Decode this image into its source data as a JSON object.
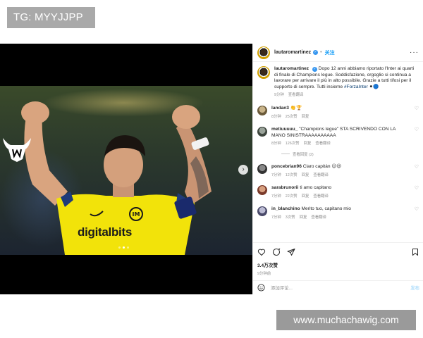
{
  "overlay": {
    "tg_label": "TG: MYYJJPP",
    "site_watermark": "www.muchachawig.com"
  },
  "post": {
    "username": "lautaromartinez",
    "verified_glyph": "✓",
    "follow_label": "关注",
    "more_label": "···",
    "image": {
      "jersey_sponsor": "digitalbits",
      "next_arrow": "›",
      "carousel_dots": 3,
      "carousel_active": 1
    },
    "caption": {
      "text": "Dopo 12 anni abbiamo riportato l'Inter ai quarti di finale di Champions legue. Soddisfazione, orgoglio si continua a lavorare per arrivare il più in alto possibile. Grazie a tutti tifosi per il supporto di sempre. Tutti insieme",
      "hashtag": "#ForzaInter",
      "emoji": "⚫🔵",
      "time": "9分钟",
      "translate": "查看翻译"
    },
    "comments": [
      {
        "user": "landan3",
        "text": "👏🏆",
        "time": "8分钟",
        "likes": "25次赞",
        "reply": "回复",
        "translate": ""
      },
      {
        "user": "metiuuuuu_",
        "text": "\"Champions legue\" STA SCRIVENDO CON LA MANO SINISTRAAAAAAAAAA",
        "time": "8分钟",
        "likes": "126次赞",
        "reply": "回复",
        "translate": "查看翻译",
        "view_replies": "查看回复 (2)"
      },
      {
        "user": "poncebrian96",
        "text": "Claro capitán 😊😍",
        "time": "7分钟",
        "likes": "12次赞",
        "reply": "回复",
        "translate": "查看翻译"
      },
      {
        "user": "sarabrunorii",
        "text": "ti amo capitano",
        "time": "7分钟",
        "likes": "22次赞",
        "reply": "回复",
        "translate": "查看翻译"
      },
      {
        "user": "in_blanchino",
        "text": "Merito tuo, capitano mio",
        "time": "7分钟",
        "likes": "3次赞",
        "reply": "回复",
        "translate": "查看翻译"
      }
    ],
    "likes": "3.4万次赞",
    "posted_ago": "9分钟前",
    "composer": {
      "placeholder": "添加评论...",
      "post_label": "发布"
    }
  },
  "colors": {
    "accent": "#0095f6",
    "verified": "#3897f0",
    "jersey": "#f2e30a"
  }
}
